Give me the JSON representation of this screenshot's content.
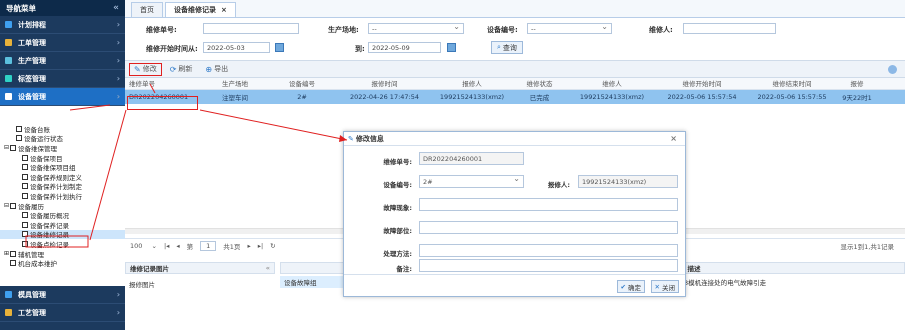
{
  "sidebar": {
    "title": "导航菜单",
    "collapse": "«",
    "groups_top": [
      {
        "label": "计划排程",
        "color": "#3fa0f0"
      },
      {
        "label": "工单管理",
        "color": "#e8b23a"
      },
      {
        "label": "生产管理",
        "color": "#5bc0de"
      },
      {
        "label": "标签管理",
        "color": "#2fd1c5"
      },
      {
        "label": "设备管理",
        "color": "#ffffff",
        "active": true
      }
    ],
    "tree": [
      {
        "pm": "",
        "label": "设备台账",
        "indent": 1
      },
      {
        "pm": "",
        "label": "设备运行状态",
        "indent": 1
      },
      {
        "pm": "⊟",
        "label": "设备维保管理",
        "indent": 0
      },
      {
        "pm": "",
        "label": "设备保项目",
        "indent": 2
      },
      {
        "pm": "",
        "label": "设备维保项目组",
        "indent": 2
      },
      {
        "pm": "",
        "label": "设备保养规则定义",
        "indent": 2
      },
      {
        "pm": "",
        "label": "设备保养计划制定",
        "indent": 2
      },
      {
        "pm": "",
        "label": "设备保养计划执行",
        "indent": 2
      },
      {
        "pm": "⊟",
        "label": "设备履历",
        "indent": 0
      },
      {
        "pm": "",
        "label": "设备履历概况",
        "indent": 2
      },
      {
        "pm": "",
        "label": "设备保养记录",
        "indent": 2
      },
      {
        "pm": "",
        "label": "设备维修记录",
        "indent": 2,
        "selected": true
      },
      {
        "pm": "",
        "label": "设备点检记录",
        "indent": 2
      },
      {
        "pm": "⊞",
        "label": "辅机管理",
        "indent": 0
      },
      {
        "pm": "",
        "label": "机台成本维护",
        "indent": 0
      }
    ],
    "groups_bottom": [
      {
        "label": "模具管理",
        "color": "#3fa0f0"
      },
      {
        "label": "工艺管理",
        "color": "#e8b23a"
      }
    ]
  },
  "tabs": [
    {
      "label": "首页",
      "active": false
    },
    {
      "label": "设备维修记录",
      "active": true,
      "close": "×"
    }
  ],
  "filters": {
    "repair_no_label": "维修单号:",
    "site_label": "生产场地:",
    "site_value": "--",
    "equip_no_label": "设备编号:",
    "equip_no_value": "--",
    "repairer_label": "维修人:",
    "start_label": "维修开始时间从:",
    "start_value": "2022-05-03",
    "to_label": "到:",
    "to_value": "2022-05-09",
    "query_label": "查询"
  },
  "toolbar": {
    "edit": "修改",
    "refresh": "刷新",
    "export": "导出"
  },
  "grid": {
    "columns": [
      "维修单号",
      "生产场地",
      "设备编号",
      "报修时间",
      "报修人",
      "维修状态",
      "维修人",
      "维修开始时间",
      "维修结束时间",
      "报修"
    ],
    "rows": [
      [
        "DR202204260001",
        "注塑车间",
        "2#",
        "2022-04-26 17:47:54",
        "19921524133(xmz)",
        "已完成",
        "19921524133(xmz)",
        "2022-05-06 15:57:54",
        "2022-05-06 15:57:55",
        "9天22时1"
      ]
    ]
  },
  "pager": {
    "size": "100",
    "page_prefix": "第",
    "page": "1",
    "total_pages": "共1页",
    "summary": "显示1到1,共1记录"
  },
  "bottom": {
    "img_header": "维修记录图片",
    "img_collapse": "«",
    "img_label": "报修图片",
    "fault_header": "故",
    "fault_label": "设备故障组",
    "desc_header": "描述",
    "desc_text": "3模机连接处的电气故障引走"
  },
  "modal": {
    "title": "修改信息",
    "close": "×",
    "repair_no_label": "维修单号:",
    "repair_no_value": "DR202204260001",
    "equip_no_label": "设备编号:",
    "equip_no_value": "2#",
    "reporter_label": "报修人:",
    "reporter_value": "19921524133(xmz)",
    "phenomenon_label": "故障现象:",
    "part_label": "故障部位:",
    "method_label": "处理方法:",
    "remark_label": "备注:",
    "ok": "确定",
    "cancel": "关闭"
  },
  "colors": {
    "sidebar_bg": "#1c3a5e",
    "active_group": "#1e6fc5",
    "selected_row": "#8fc3ef",
    "annotation_red": "#e02020"
  }
}
